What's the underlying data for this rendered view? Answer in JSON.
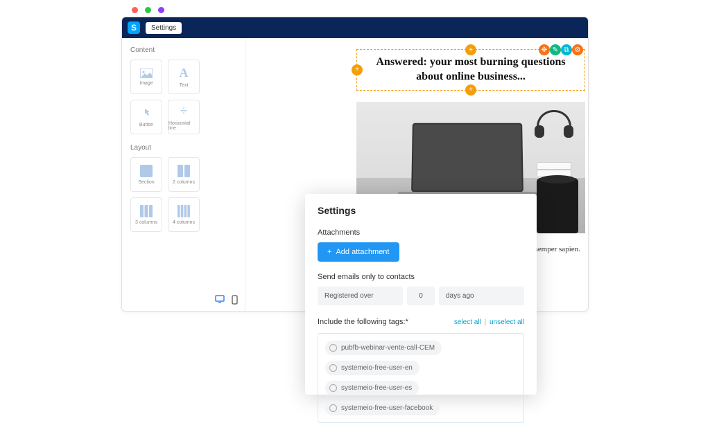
{
  "topbar": {
    "logo_letter": "S",
    "settings_label": "Settings"
  },
  "sidebar": {
    "content_label": "Content",
    "layout_label": "Layout",
    "content": {
      "image": "Image",
      "text": "Text",
      "button": "Button",
      "hr": "Horizontal line"
    },
    "layout": {
      "section": "Section",
      "c2": "2 columns",
      "c3": "3 columns",
      "c4": "4 columns"
    }
  },
  "canvas": {
    "headline": "Answered: your most burning questions about online business...",
    "body": "sed velit vitae t nec orci semper sapien. egestas. Etiam"
  },
  "modal": {
    "title": "Settings",
    "attachments_label": "Attachments",
    "add_attachment": "Add attachment",
    "send_label": "Send emails only to contacts",
    "registered_over": "Registered over",
    "days_value": "0",
    "days_ago": "days ago",
    "tags_label": "Include the following tags:*",
    "select_all": "select all",
    "unselect_all": "unselect all",
    "tags": [
      "pubfb-webinar-vente-call-CEM",
      "systemeio-free-user-en",
      "systemeio-free-user-es",
      "systemeio-free-user-facebook"
    ]
  }
}
